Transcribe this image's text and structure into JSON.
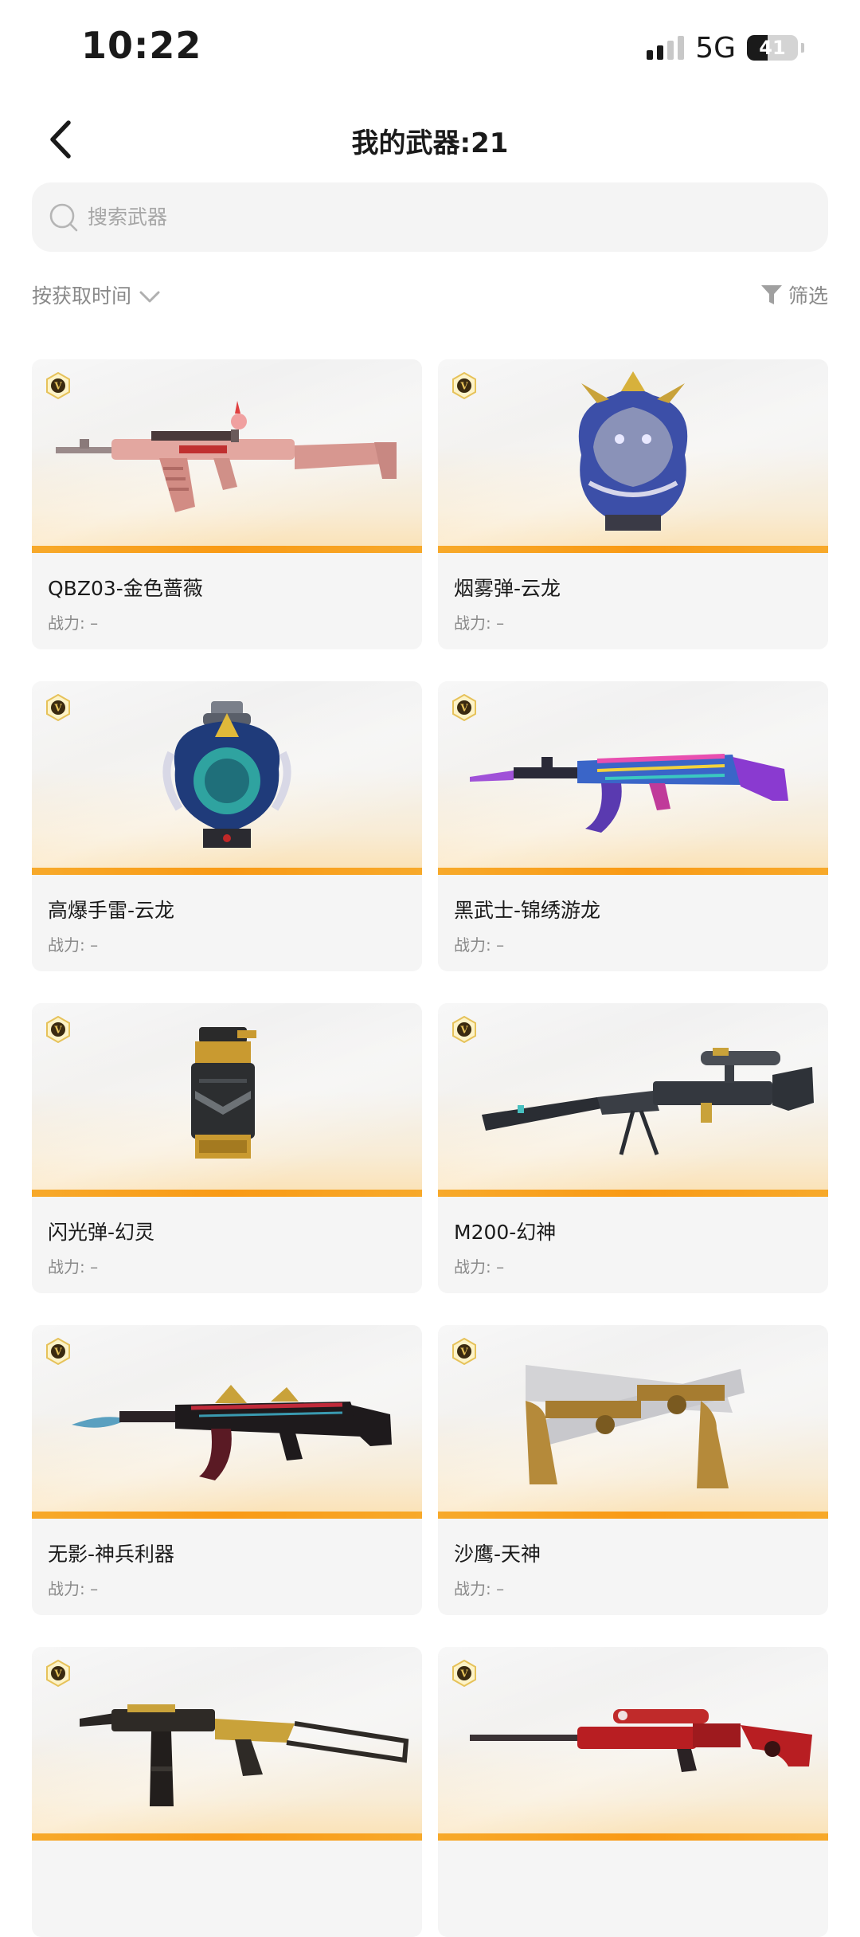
{
  "status": {
    "time": "10:22",
    "network": "5G",
    "battery": "41",
    "battery_level": 0.41
  },
  "header": {
    "title": "我的武器:21"
  },
  "search": {
    "placeholder": "搜索武器"
  },
  "toolbar": {
    "sort_label": "按获取时间",
    "filter_label": "筛选"
  },
  "icons": {
    "back": "chevron-left-icon",
    "search": "search-icon",
    "sort": "chevron-down-icon",
    "filter": "filter-icon",
    "badge": "v-badge-icon"
  },
  "colors": {
    "accent_bar": "#f99a15",
    "card_bg": "#f5f5f5",
    "text_secondary": "#8a8a8a"
  },
  "weapons": [
    {
      "name": "QBZ03-金色蔷薇",
      "power": "战力: –",
      "art": "rifle-pink"
    },
    {
      "name": "烟雾弹-云龙",
      "power": "战力: –",
      "art": "dragon-head"
    },
    {
      "name": "高爆手雷-云龙",
      "power": "战力: –",
      "art": "dragon-grenade"
    },
    {
      "name": "黑武士-锦绣游龙",
      "power": "战力: –",
      "art": "rifle-holo"
    },
    {
      "name": "闪光弹-幻灵",
      "power": "战力: –",
      "art": "flash-canister"
    },
    {
      "name": "M200-幻神",
      "power": "战力: –",
      "art": "sniper-dark"
    },
    {
      "name": "无影-神兵利器",
      "power": "战力: –",
      "art": "rifle-blade"
    },
    {
      "name": "沙鹰-天神",
      "power": "战力: –",
      "art": "pistol-gold"
    },
    {
      "name": "",
      "power": "",
      "art": "smg-gold"
    },
    {
      "name": "",
      "power": "",
      "art": "sniper-red"
    }
  ]
}
